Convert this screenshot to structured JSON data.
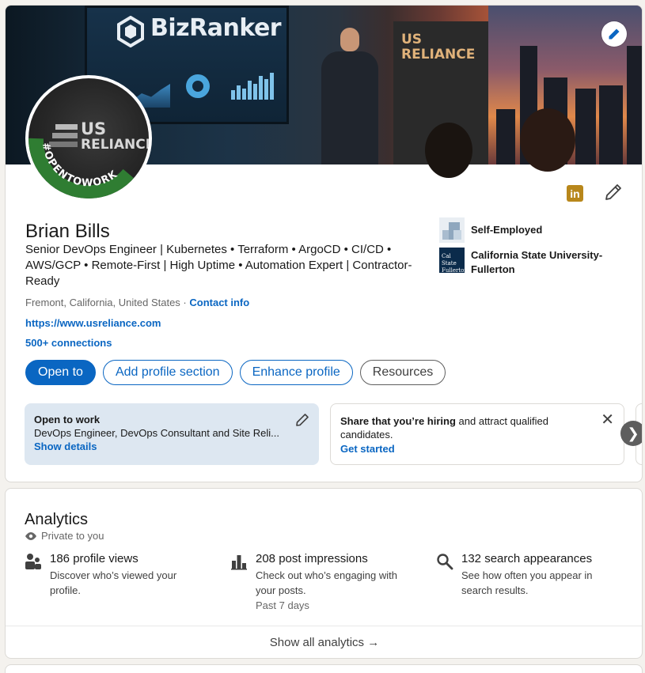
{
  "banner": {
    "screen_logo": "BizRanker",
    "wall_sign_line1": "US",
    "wall_sign_line2": "RELIANCE"
  },
  "avatar": {
    "logo_line1": "US",
    "logo_line2": "RELIANCE",
    "badge": "#OPENTOWORK",
    "badge_color": "#2f7d32"
  },
  "profile": {
    "name": "Brian Bills",
    "headline": "Senior DevOps Engineer | Kubernetes • Terraform • ArgoCD • CI/CD • AWS/GCP • Remote-First | High Uptime • Automation Expert | Contractor-Ready",
    "location": "Fremont, California, United States",
    "location_sep": " · ",
    "contact_info": "Contact info",
    "website": "https://www.usreliance.com",
    "connections": "500+ connections",
    "linkedin_badge": "in"
  },
  "orgs": [
    {
      "name": "Self-Employed",
      "icon": "building-icon"
    },
    {
      "name": "California State University-Fullerton",
      "icon": "csuf-logo",
      "logo_text": "Cal State Fullerton"
    }
  ],
  "actions": {
    "open_to": "Open to",
    "add_section": "Add profile section",
    "enhance": "Enhance profile",
    "resources": "Resources"
  },
  "open_to_work": {
    "title": "Open to work",
    "roles": "DevOps Engineer, DevOps Consultant and Site Reli...",
    "link": "Show details"
  },
  "hiring": {
    "bold": "Share that you’re hiring",
    "rest": " and attract qualified candidates.",
    "link": "Get started",
    "close": "✕"
  },
  "carousel_next": "❯",
  "analytics": {
    "title": "Analytics",
    "private": "Private to you",
    "metrics": [
      {
        "icon": "people-icon",
        "heading": "186 profile views",
        "desc": "Discover who’s viewed your profile.",
        "period": ""
      },
      {
        "icon": "bar-chart-icon",
        "heading": "208 post impressions",
        "desc": "Check out who’s engaging with your posts.",
        "period": "Past 7 days"
      },
      {
        "icon": "search-icon",
        "heading": "132 search appearances",
        "desc": "See how often you appear in search results.",
        "period": ""
      }
    ],
    "footer": "Show all analytics →"
  },
  "colors": {
    "primary": "#0a66c2",
    "otw_bg": "#dde7f1",
    "linkedin_gold": "#b8871b"
  }
}
